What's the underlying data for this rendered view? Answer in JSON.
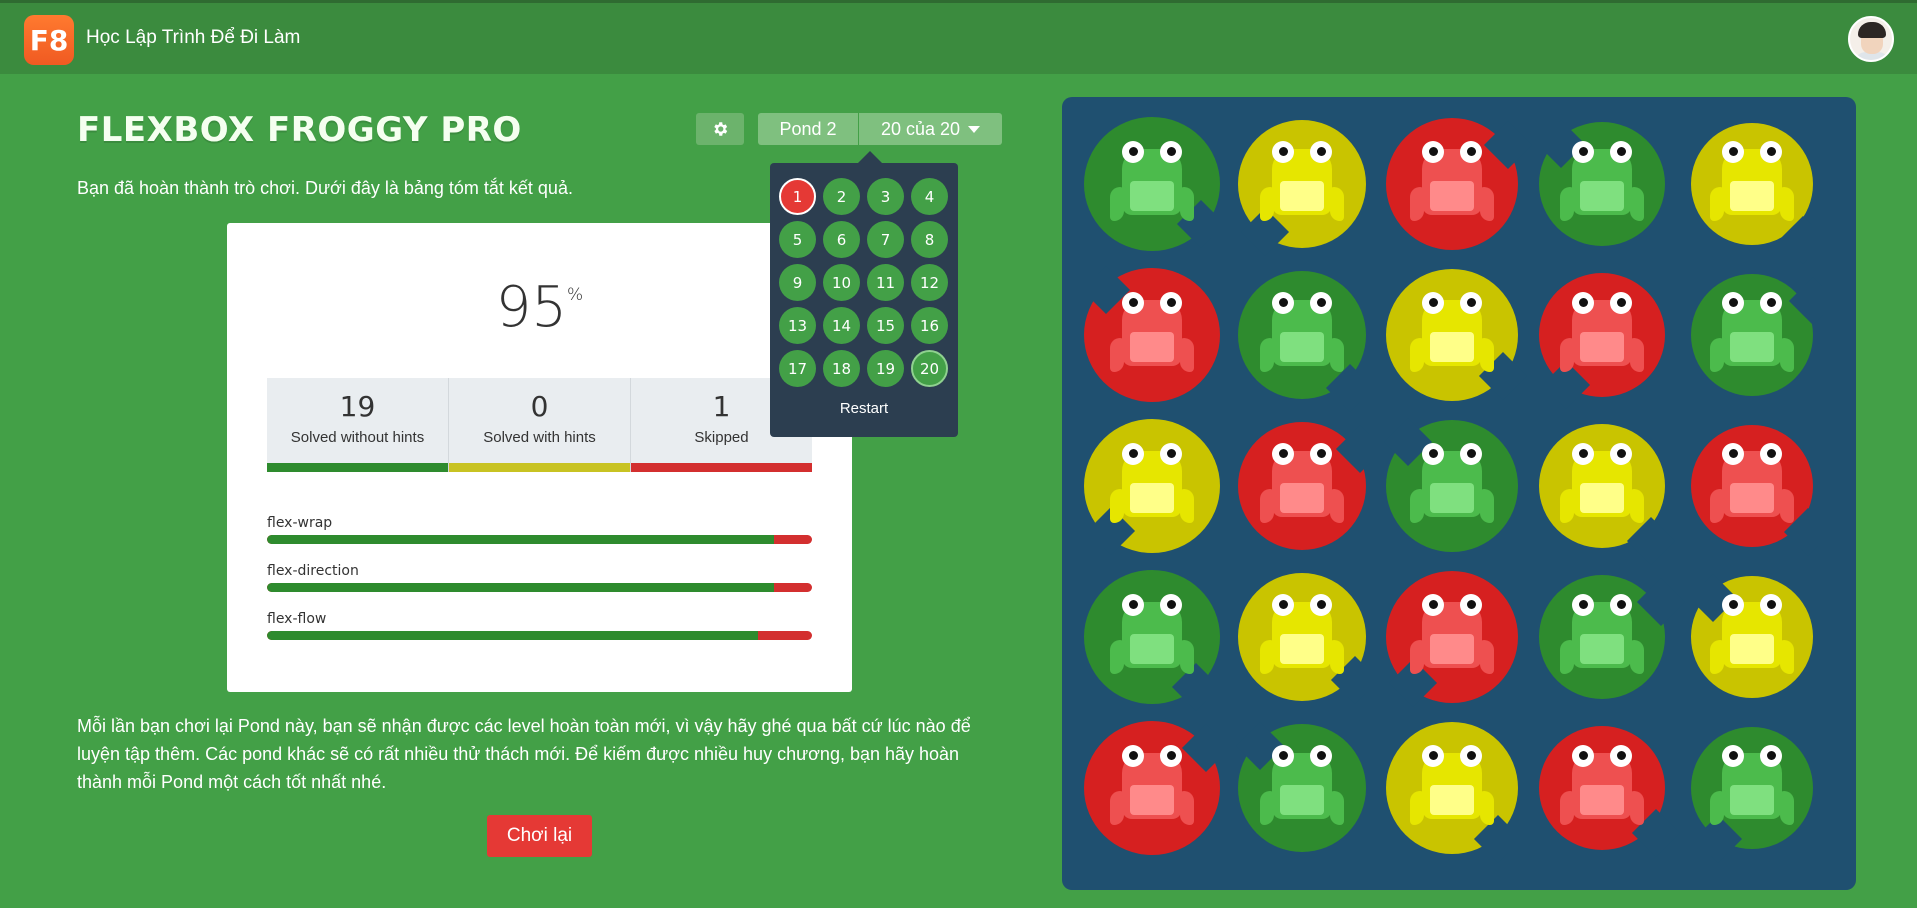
{
  "header": {
    "logo_text": "F8",
    "site_title": "Học Lập Trình Để Đi Làm"
  },
  "game": {
    "title": "FLEXBOX FROGGY PRO",
    "intro": "Bạn đã hoàn thành trò chơi. Dưới đây là bảng tóm tắt kết quả.",
    "pond_label": "Pond 2",
    "level_label": "20 của 20",
    "settings_icon": "gear-icon"
  },
  "results": {
    "score": "95",
    "score_unit": "%",
    "stats": [
      {
        "value": "19",
        "label": "Solved without hints",
        "color": "#2e8b2e"
      },
      {
        "value": "0",
        "label": "Solved with hints",
        "color": "#c8c323"
      },
      {
        "value": "1",
        "label": "Skipped",
        "color": "#d32f2f"
      }
    ],
    "skills": [
      {
        "name": "flex-wrap",
        "progress": 0.93
      },
      {
        "name": "flex-direction",
        "progress": 0.93
      },
      {
        "name": "flex-flow",
        "progress": 0.9
      }
    ]
  },
  "outro": "Mỗi lần bạn chơi lại Pond này, bạn sẽ nhận được các level hoàn toàn mới, vì vậy hãy ghé qua bất cứ lúc nào để luyện tập thêm. Các pond khác sẽ có rất nhiều thử thách mới. Để kiếm được nhiều huy chương, bạn hãy hoàn thành mỗi Pond một cách tốt nhất nhé.",
  "replay_label": "Chơi lại",
  "level_menu": {
    "levels": [
      "1",
      "2",
      "3",
      "4",
      "5",
      "6",
      "7",
      "8",
      "9",
      "10",
      "11",
      "12",
      "13",
      "14",
      "15",
      "16",
      "17",
      "18",
      "19",
      "20"
    ],
    "failed_level": "1",
    "current_level": "20",
    "restart_label": "Restart"
  },
  "board": {
    "colors": {
      "green": {
        "pad": "#2e8b2e",
        "frog": "#4cbb4c",
        "belly": "#7fe07f"
      },
      "yellow": {
        "pad": "#c9c400",
        "frog": "#e6e600",
        "belly": "#ffff88"
      },
      "red": {
        "pad": "#d62020",
        "frog": "#ee5050",
        "belly": "#ff8a8a"
      }
    },
    "rows": [
      [
        "green",
        "yellow",
        "red",
        "green",
        "yellow"
      ],
      [
        "red",
        "green",
        "yellow",
        "red",
        "green"
      ],
      [
        "yellow",
        "red",
        "green",
        "yellow",
        "red"
      ],
      [
        "green",
        "yellow",
        "red",
        "green",
        "yellow"
      ],
      [
        "red",
        "green",
        "yellow",
        "red",
        "green"
      ]
    ]
  }
}
